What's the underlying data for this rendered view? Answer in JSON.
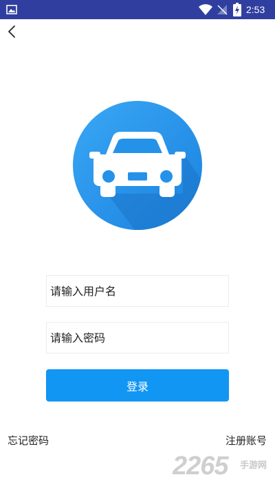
{
  "status_bar": {
    "time": "2:53",
    "background": "#303f9f",
    "icons": [
      "gallery-icon",
      "wifi-icon",
      "signal-off-icon",
      "battery-charging-icon"
    ]
  },
  "header": {
    "back_icon": "chevron-left-icon"
  },
  "logo": {
    "icon": "car-icon",
    "circle_color": "#1e8ee8",
    "shadow_color": "#1b74c8"
  },
  "form": {
    "username_placeholder": "请输入用户名",
    "password_placeholder": "请输入密码",
    "login_label": "登录",
    "accent_color": "#1196f3"
  },
  "footer": {
    "forgot_password": "忘记密码",
    "register": "注册账号"
  },
  "watermark": {
    "number": "2265",
    "site": "手游网"
  }
}
